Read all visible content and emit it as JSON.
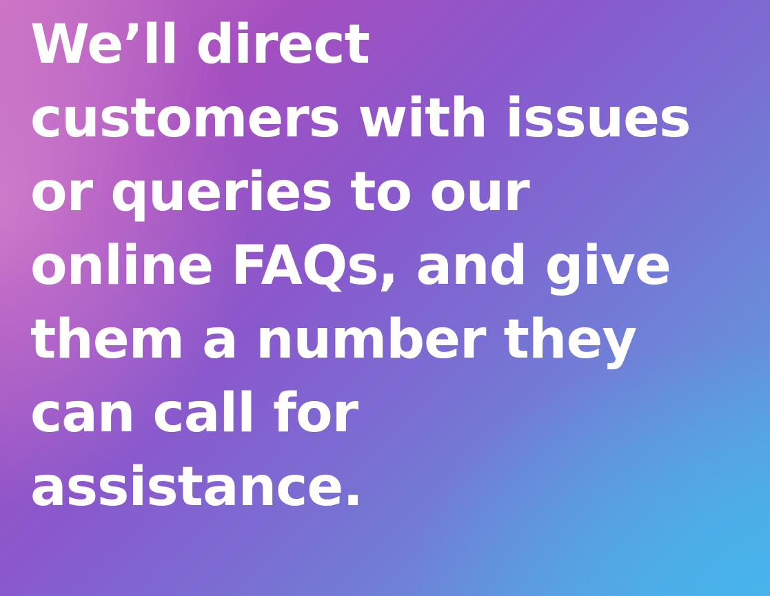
{
  "headline": {
    "lines": [
      "We’ll direct",
      "customers with issues",
      "or queries to our",
      "online FAQs, and give",
      "them a number they",
      "can call for",
      "assistance."
    ]
  },
  "colors": {
    "text": "#ffffff",
    "gradient_start": "#c86fc4",
    "gradient_mid": "#8a58cc",
    "gradient_end": "#4fb0e6"
  }
}
